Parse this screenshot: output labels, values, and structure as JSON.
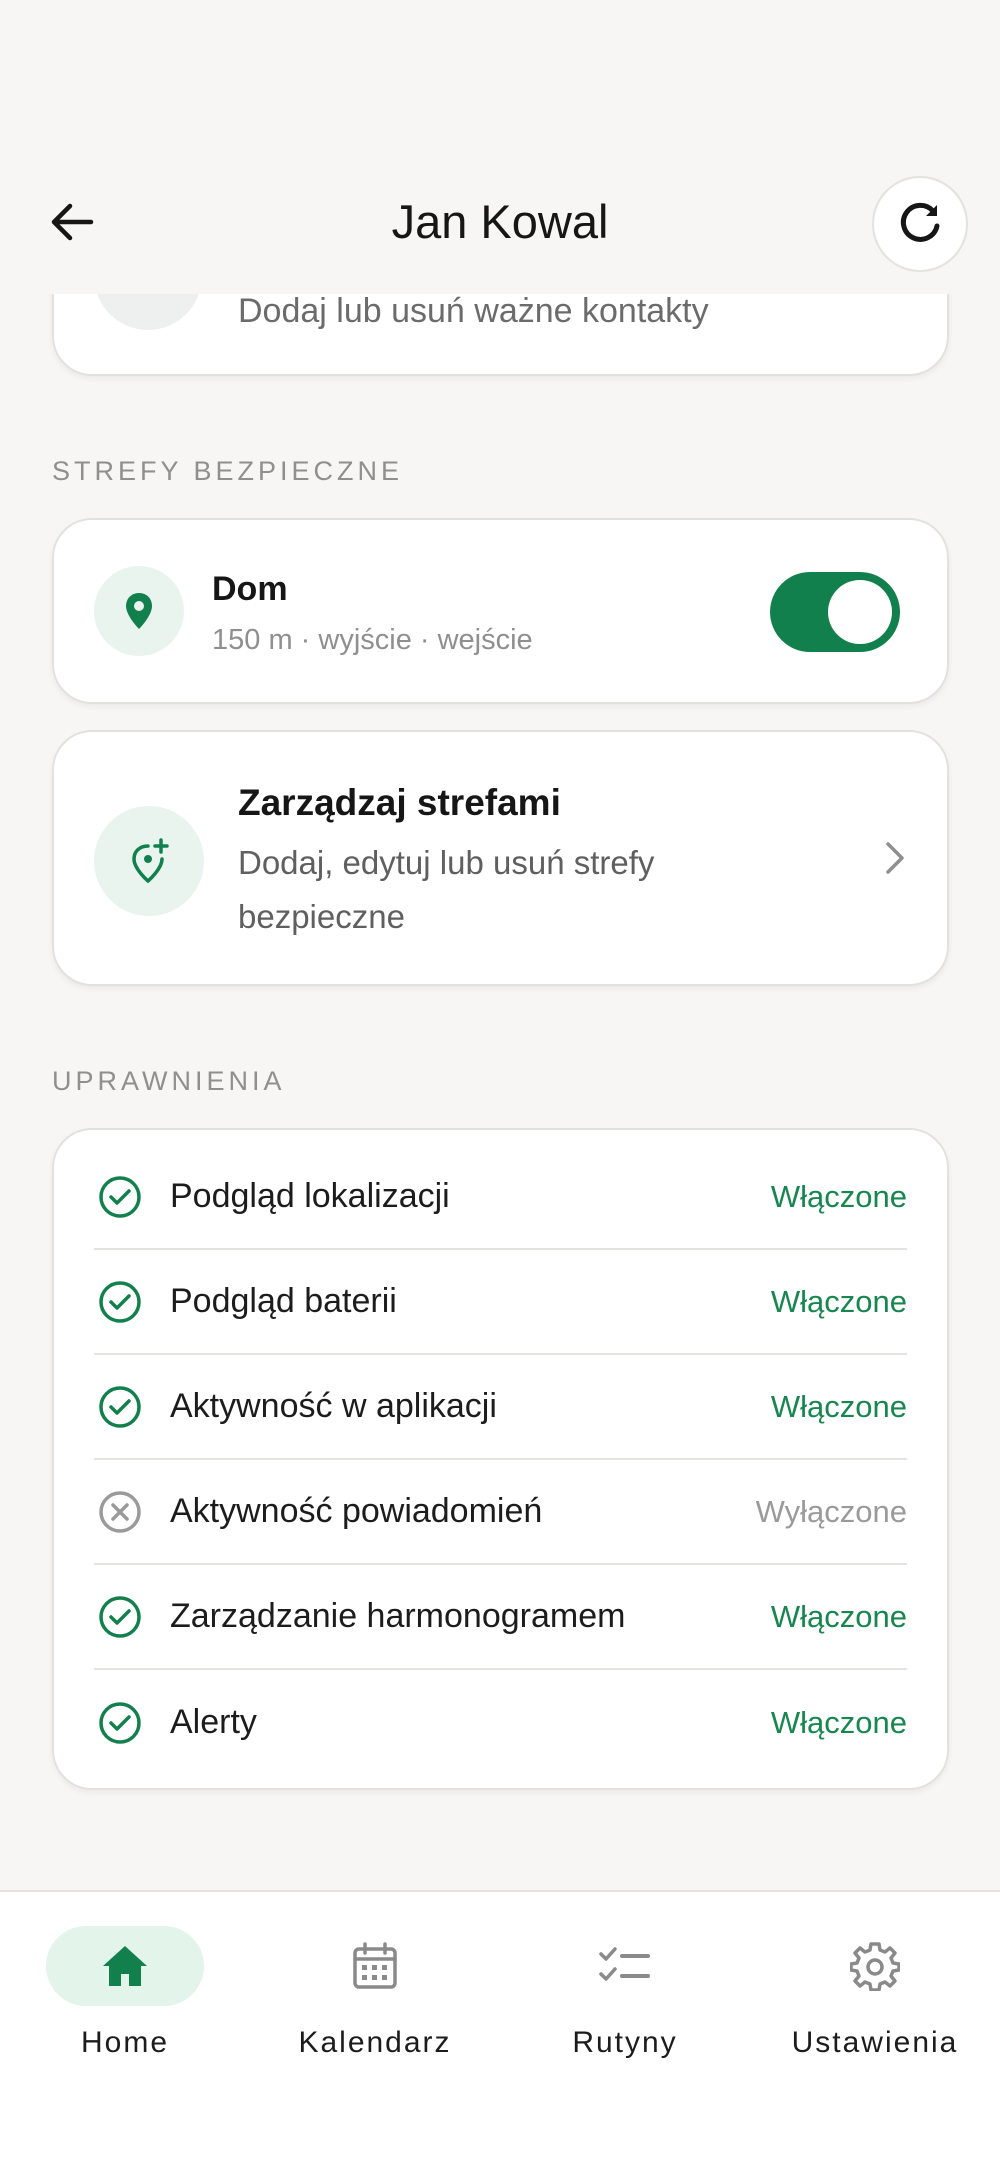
{
  "header": {
    "title": "Jan Kowal",
    "back_icon": "arrow-left-icon",
    "refresh_icon": "refresh-icon"
  },
  "contacts": {
    "subtitle": "Dodaj lub usuń ważne kontakty"
  },
  "safe_zones": {
    "section_label": "STREFY BEZPIECZNE",
    "zone": {
      "name": "Dom",
      "meta": "150 m · wyjście · wejście",
      "enabled": true
    },
    "manage": {
      "title": "Zarządzaj strefami",
      "description": "Dodaj, edytuj lub usuń strefy bezpieczne"
    }
  },
  "permissions": {
    "section_label": "UPRAWNIENIA",
    "items": [
      {
        "label": "Podgląd lokalizacji",
        "status": "Włączone",
        "enabled": true
      },
      {
        "label": "Podgląd baterii",
        "status": "Włączone",
        "enabled": true
      },
      {
        "label": "Aktywność w aplikacji",
        "status": "Włączone",
        "enabled": true
      },
      {
        "label": "Aktywność powiadomień",
        "status": "Wyłączone",
        "enabled": false
      },
      {
        "label": "Zarządzanie harmonogramem",
        "status": "Włączone",
        "enabled": true
      },
      {
        "label": "Alerty",
        "status": "Włączone",
        "enabled": true
      }
    ]
  },
  "nav": {
    "items": [
      {
        "label": "Home",
        "icon": "home-icon",
        "active": true
      },
      {
        "label": "Kalendarz",
        "icon": "calendar-icon",
        "active": false
      },
      {
        "label": "Rutyny",
        "icon": "checklist-icon",
        "active": false
      },
      {
        "label": "Ustawienia",
        "icon": "gear-icon",
        "active": false
      }
    ]
  },
  "colors": {
    "accent": "#12804d",
    "enabled_text": "#17874f",
    "disabled_text": "#9a9a9a",
    "background": "#f7f6f4"
  }
}
